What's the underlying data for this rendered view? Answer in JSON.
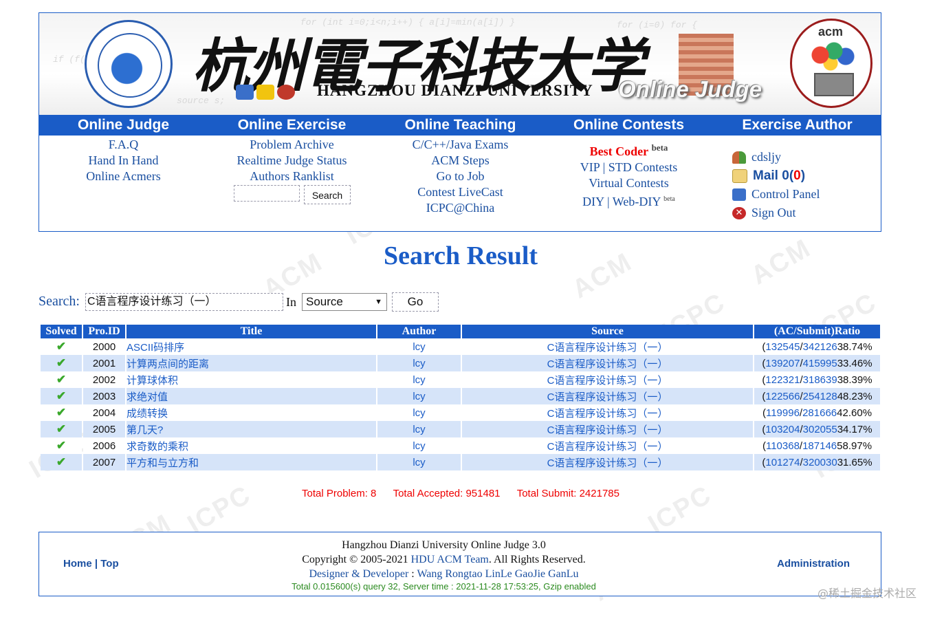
{
  "colors": {
    "nav_blue": "#1a5cc7",
    "link_blue": "#1a4fa0",
    "accent_red": "#e00000",
    "row_alt": "#d6e4f9",
    "ok_green": "#3aa82b"
  },
  "banner": {
    "title_cn": "杭州電子科技大学",
    "title_en": "HANGZHOU DIANZI UNIVERSITY",
    "tag": "Online Judge",
    "acm_text": "acm"
  },
  "nav": {
    "columns": [
      {
        "header": "Online Judge",
        "links": [
          "F.A.Q",
          "Hand In Hand",
          "Online Acmers"
        ]
      },
      {
        "header": "Online Exercise",
        "links": [
          "Problem Archive",
          "Realtime Judge Status",
          "Authors Ranklist"
        ],
        "search_button": "Search"
      },
      {
        "header": "Online Teaching",
        "links": [
          "C/C++/Java Exams",
          "ACM Steps",
          "Go to Job",
          "Contest LiveCast",
          "ICPC@China"
        ]
      },
      {
        "header": "Online Contests",
        "best_coder": "Best Coder",
        "beta": "beta",
        "vip": "VIP",
        "sep": "|",
        "std": "STD Contests",
        "virtual": "Virtual Contests",
        "diy": "DIY",
        "webdiy": "Web-DIY",
        "beta2": "beta"
      },
      {
        "header": "Exercise Author"
      }
    ]
  },
  "author": {
    "username": "cdsljy",
    "mail_label": "Mail 0",
    "mail_open": "(",
    "mail_count": "0",
    "mail_close": ")",
    "control_panel": "Control Panel",
    "sign_out": "Sign Out"
  },
  "page": {
    "title": "Search Result",
    "search_label": "Search:",
    "search_value": "C语言程序设计练习（一）",
    "in_label": "In",
    "select_value": "Source",
    "go_button": "Go"
  },
  "table": {
    "headers": [
      "Solved",
      "Pro.ID",
      "Title",
      "Author",
      "Source",
      "(AC/Submit)Ratio"
    ],
    "rows": [
      {
        "id": "2000",
        "title": "ASCII码排序",
        "author": "lcy",
        "source": "C语言程序设计练习（一）",
        "ac": "132545",
        "submit": "342126",
        "ratio": "38.74%"
      },
      {
        "id": "2001",
        "title": "计算两点间的距离",
        "author": "lcy",
        "source": "C语言程序设计练习（一）",
        "ac": "139207",
        "submit": "415995",
        "ratio": "33.46%"
      },
      {
        "id": "2002",
        "title": "计算球体积",
        "author": "lcy",
        "source": "C语言程序设计练习（一）",
        "ac": "122321",
        "submit": "318639",
        "ratio": "38.39%"
      },
      {
        "id": "2003",
        "title": "求绝对值",
        "author": "lcy",
        "source": "C语言程序设计练习（一）",
        "ac": "122566",
        "submit": "254128",
        "ratio": "48.23%"
      },
      {
        "id": "2004",
        "title": "成绩转换",
        "author": "lcy",
        "source": "C语言程序设计练习（一）",
        "ac": "119996",
        "submit": "281666",
        "ratio": "42.60%"
      },
      {
        "id": "2005",
        "title": "第几天?",
        "author": "lcy",
        "source": "C语言程序设计练习（一）",
        "ac": "103204",
        "submit": "302055",
        "ratio": "34.17%"
      },
      {
        "id": "2006",
        "title": "求奇数的乘积",
        "author": "lcy",
        "source": "C语言程序设计练习（一）",
        "ac": "110368",
        "submit": "187146",
        "ratio": "58.97%"
      },
      {
        "id": "2007",
        "title": "平方和与立方和",
        "author": "lcy",
        "source": "C语言程序设计练习（一）",
        "ac": "101274",
        "submit": "320030",
        "ratio": "31.65%"
      }
    ]
  },
  "totals": {
    "problem": "Total Problem: 8",
    "accepted": "Total Accepted: 951481",
    "submit": "Total Submit: 2421785"
  },
  "footer": {
    "home": "Home",
    "sep": "|",
    "top": "Top",
    "line1": "Hangzhou Dianzi University Online Judge 3.0",
    "copyright_prefix": "Copyright © 2005-2021",
    "team": "HDU ACM Team",
    "rights": ". All Rights Reserved.",
    "designer_label": "Designer & Developer",
    "colon": " : ",
    "designers": "Wang Rongtao LinLe GaoJie GanLu",
    "stats": "Total 0.015600(s) query 32, Server time : 2021-11-28 17:53:25, Gzip enabled",
    "admin": "Administration"
  },
  "watermark": {
    "text1": "ACM",
    "text2": "ICPC",
    "corner": "@稀土掘金技术社区"
  }
}
